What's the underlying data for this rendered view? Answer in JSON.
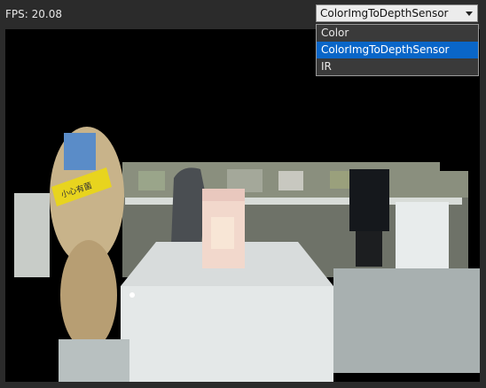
{
  "header": {
    "fps_label": "FPS:",
    "fps_value": "20.08"
  },
  "mode_select": {
    "selected": "ColorImgToDepthSensor",
    "options": [
      "Color",
      "ColorImgToDepthSensor",
      "IR"
    ],
    "selected_index": 1
  },
  "colors": {
    "window_bg": "#2b2b2b",
    "viewport_bg": "#000000",
    "selection": "#0a66c8"
  },
  "icons": {
    "dropdown": "chevron-down-icon"
  },
  "scene": {
    "signage_text": "小心有菌"
  }
}
